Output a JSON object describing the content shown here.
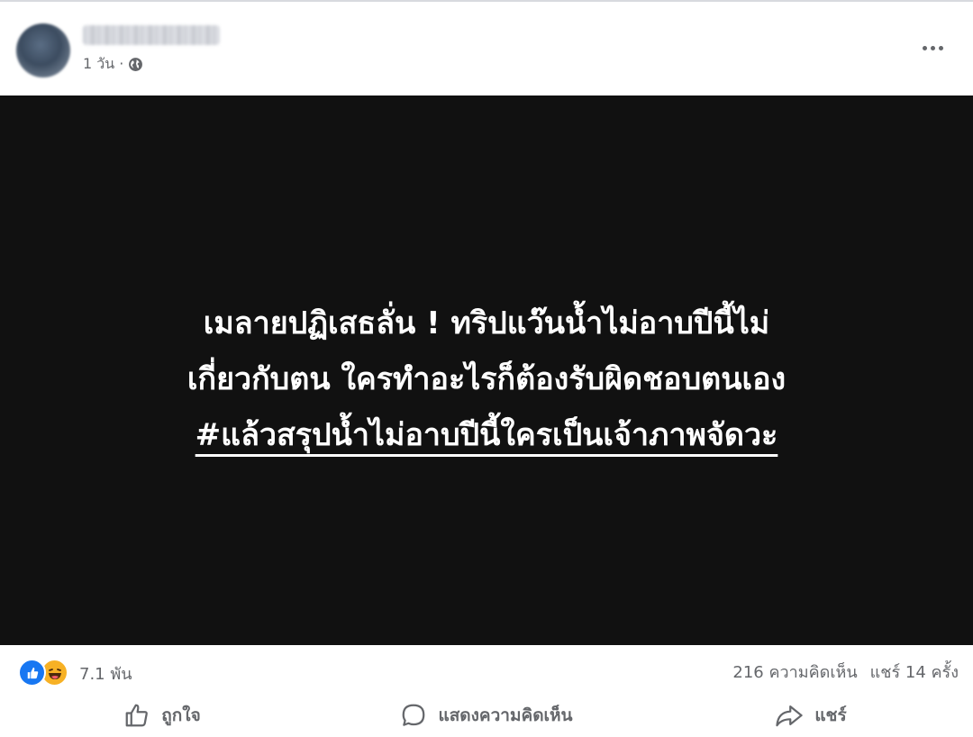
{
  "post": {
    "time": "1 วัน ·",
    "privacy_icon": "globe-icon",
    "image_text": {
      "line1": "เมลายปฏิเสธลั่น ! ทริปแว๊นน้ำไม่อาบปีนี้ไม่",
      "line2": "เกี่ยวกับตน ใครทำอะไรก็ต้องรับผิดชอบตนเอง",
      "line3": "#แล้วสรุปน้ำไม่อาบปีนี้ใครเป็นเจ้าภาพจัดวะ"
    }
  },
  "stats": {
    "reaction_count": "7.1 พัน",
    "comments": "216 ความคิดเห็น",
    "shares": "แชร์ 14 ครั้ง"
  },
  "actions": {
    "like": "ถูกใจ",
    "comment": "แสดงความคิดเห็น",
    "share": "แชร์"
  },
  "colors": {
    "like_blue": "#1877f2",
    "haha_yellow": "#f7b125",
    "secondary_text": "#65676b",
    "image_bg": "#111111"
  }
}
